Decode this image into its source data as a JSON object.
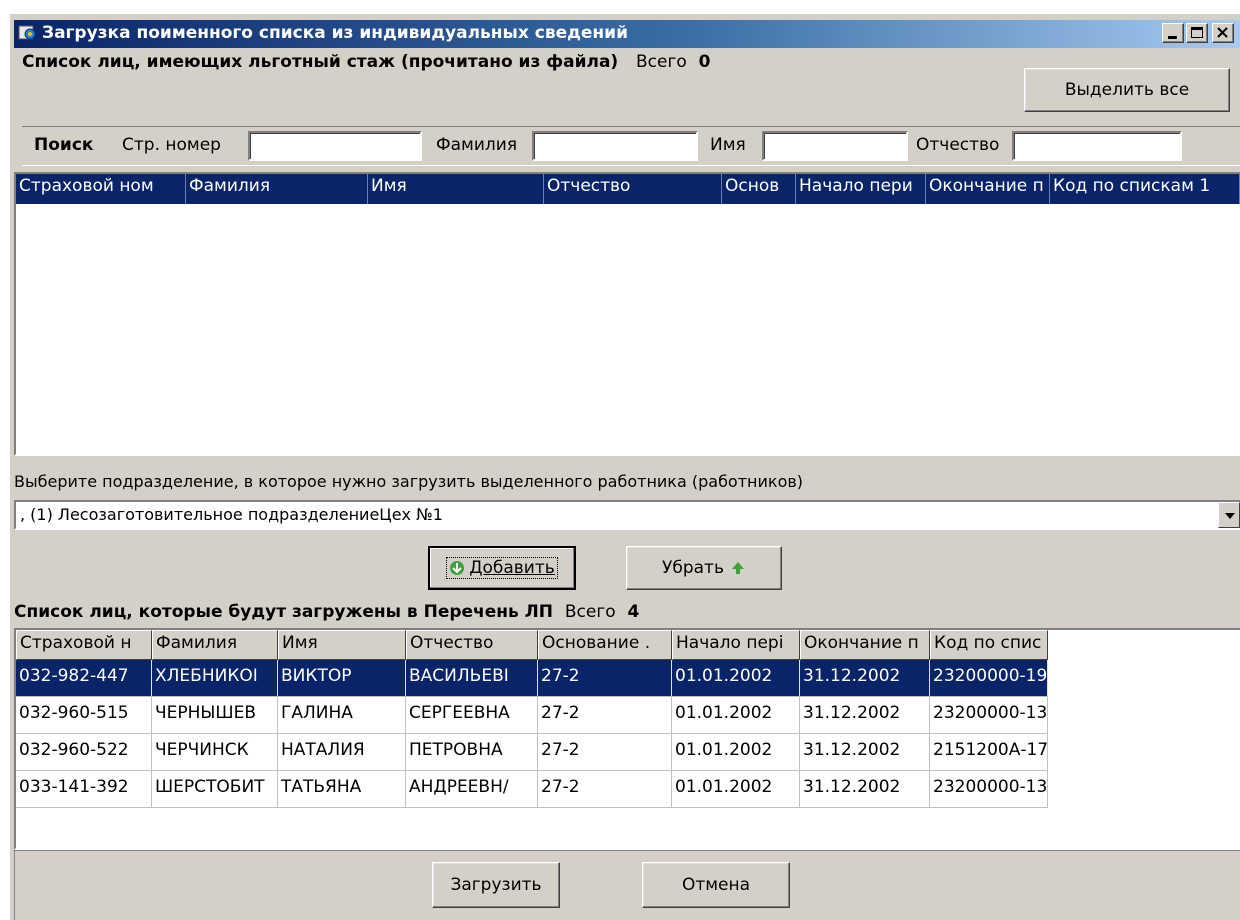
{
  "window": {
    "title": "Загрузка поименного списка из индивидуальных сведений"
  },
  "source": {
    "title": "Список лиц, имеющих льготный стаж (прочитано из файла)",
    "total_label": "Всего",
    "total_value": "0",
    "select_all_label": "Выделить все"
  },
  "search": {
    "label": "Поиск",
    "ins_label": "Стр. номер",
    "ins_value": "",
    "last_label": "Фамилия",
    "last_value": "",
    "first_label": "Имя",
    "first_value": "",
    "middle_label": "Отчество",
    "middle_value": ""
  },
  "top_columns": [
    "Страховой ном",
    "Фамилия",
    "Имя",
    "Отчество",
    "Основ",
    "Начало пери",
    "Окончание п",
    "Код по спискам 1"
  ],
  "subdivision": {
    "prompt": "Выберите подразделение, в которое нужно загрузить выделенного работника (работников)",
    "selected": ", (1) Лесозаготовительное подразделениеЦех №1"
  },
  "actions": {
    "add_label": "Добавить",
    "remove_label": "Убрать"
  },
  "target": {
    "title": "Список лиц, которые будут загружены в Перечень ЛП",
    "total_label": "Всего",
    "total_value": "4"
  },
  "bottom_columns": [
    "Страховой н",
    "Фамилия",
    "Имя",
    "Отчество",
    "Основание .",
    "Начало пері",
    "Окончание п",
    "Код по спис"
  ],
  "rows": [
    [
      "032-982-447",
      "ХЛЕБНИКОІ",
      "ВИКТОР",
      "ВАСИЛЬЕВІ",
      "27-2",
      "01.01.2002",
      "31.12.2002",
      "23200000-19"
    ],
    [
      "032-960-515",
      "ЧЕРНЫШЕВ",
      "ГАЛИНА",
      "СЕРГЕЕВНА",
      "27-2",
      "01.01.2002",
      "31.12.2002",
      "23200000-13"
    ],
    [
      "032-960-522",
      "ЧЕРЧИНСК",
      "НАТАЛИЯ",
      "ПЕТРОВНА",
      "27-2",
      "01.01.2002",
      "31.12.2002",
      "2151200А-17"
    ],
    [
      "033-141-392",
      "ШЕРСТОБИТ",
      "ТАТЬЯНА",
      "АНДРЕЕВН/",
      "27-2",
      "01.01.2002",
      "31.12.2002",
      "23200000-13"
    ]
  ],
  "footer": {
    "load_label": "Загрузить",
    "cancel_label": "Отмена"
  }
}
